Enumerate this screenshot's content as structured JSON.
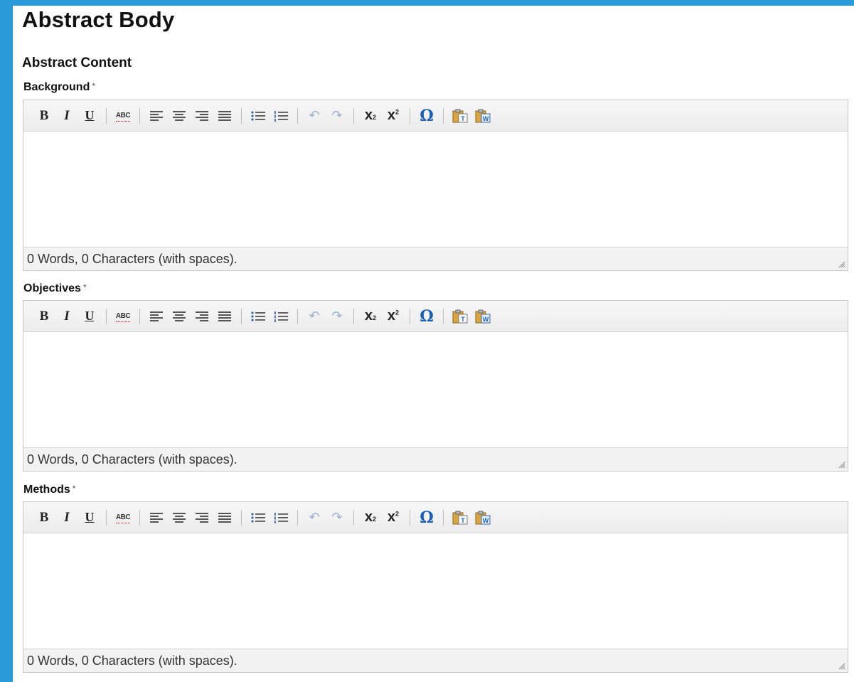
{
  "page": {
    "title": "Abstract Body",
    "subsection": "Abstract Content"
  },
  "toolbar_icons": [
    "bold-icon",
    "italic-icon",
    "underline-icon",
    "spellcheck-icon",
    "align-left-icon",
    "align-center-icon",
    "align-right-icon",
    "align-justify-icon",
    "bulleted-list-icon",
    "numbered-list-icon",
    "undo-icon",
    "redo-icon",
    "subscript-icon",
    "superscript-icon",
    "special-character-icon",
    "paste-text-icon",
    "paste-word-icon"
  ],
  "toolbar": {
    "bold": "B",
    "italic": "I",
    "underline": "U",
    "spellcheck": "ABC",
    "subscript": "x",
    "superscript": "x",
    "special_char": "Ω"
  },
  "fields": [
    {
      "label": "Background",
      "required_mark": "*",
      "status": "0 Words, 0 Characters (with spaces)."
    },
    {
      "label": "Objectives",
      "required_mark": "*",
      "status": "0 Words, 0 Characters (with spaces)."
    },
    {
      "label": "Methods",
      "required_mark": "*",
      "status": "0 Words, 0 Characters (with spaces)."
    }
  ],
  "colors": {
    "frame": "#2b9bd8",
    "toolbar_bg": "#ececec",
    "status_bg": "#f2f2f2",
    "omega": "#1b5fb4"
  }
}
